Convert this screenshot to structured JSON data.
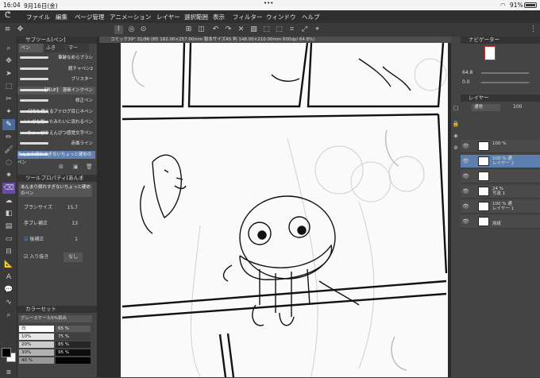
{
  "status_bar": {
    "time": "16:04",
    "date": "9月16日(金)",
    "battery": "91%",
    "dots": "•••"
  },
  "menu": [
    "ファイル",
    "編集",
    "ページ管理",
    "アニメーション",
    "レイヤー",
    "選択範囲",
    "表示",
    "フィルター",
    "ウィンドウ",
    "ヘルプ"
  ],
  "document_tab": "コミック39° 31/86 (B5 182.00×257.00mm 製本サイズA5 判 148.00×210.00mm 600dpi 64.8%)",
  "subtool_panel": {
    "title": "サブツール[ペン]",
    "tabs": [
      "ペン",
      "ふき",
      "マー"
    ],
    "brushes": [
      {
        "label": "筆跡なめらブラシ",
        "selected": false,
        "wide": false
      },
      {
        "label": "軽チャペン2",
        "selected": false,
        "wide": false
      },
      {
        "label": "ブリスター",
        "selected": false,
        "wide": false
      },
      {
        "label": "【再UP】 漫画インクペン",
        "selected": false,
        "wide": true
      },
      {
        "label": "修正ペン",
        "selected": false,
        "wide": false
      },
      {
        "label": "何でも使えるアナログ目じネペン",
        "selected": false,
        "wide": false
      },
      {
        "label": "トンボを削ったみたいに流れるペン",
        "selected": false,
        "wide": false
      },
      {
        "label": "ちょっぴりえんぴつ感覚文字ペン",
        "selected": false,
        "wide": false
      },
      {
        "label": "赤面ライン",
        "selected": false,
        "wide": false
      },
      {
        "label": "あんまり倒れすぎないちょっと硬めのペン",
        "selected": true,
        "wide": false
      }
    ]
  },
  "tool_property": {
    "title": "ツールプロパティ[あんま",
    "preset": "あんまり倒れすぎないちょっと硬めのペン",
    "brush_size_label": "ブラシサイズ",
    "brush_size_value": "15.7",
    "stabilization_label": "手ブレ補正",
    "stabilization_value": "13",
    "post_correction_label": "後補正",
    "post_correction_value": "1",
    "entry_exit_label": "入り抜き",
    "entry_exit_value": "なし"
  },
  "color_set": {
    "title": "カラーセット",
    "set_name": "グレースケール5%刻み",
    "grays": [
      {
        "label": "白",
        "pct": "65 %",
        "left": "#ffffff",
        "right": "#595959"
      },
      {
        "label": "10%",
        "pct": "75 %",
        "left": "#e6e6e6",
        "right": "#404040"
      },
      {
        "label": "20%",
        "pct": "85 %",
        "left": "#cccccc",
        "right": "#262626"
      },
      {
        "label": "30%",
        "pct": "95 %",
        "left": "#b3b3b3",
        "right": "#0d0d0d"
      },
      {
        "label": "40 %",
        "pct": "",
        "left": "#999999",
        "right": "#000000"
      }
    ]
  },
  "navigator": {
    "title": "ナビゲーター",
    "zoom": "64.8",
    "angle": "0.0"
  },
  "layer_panel": {
    "title": "レイヤー",
    "blend_mode": "通常",
    "opacity": "100",
    "layers": [
      {
        "opacity": "100 %",
        "name": "",
        "selected": false
      },
      {
        "opacity": "100 % 通",
        "name": "レイヤー 2",
        "selected": true
      },
      {
        "opacity": "",
        "name": "",
        "selected": false
      },
      {
        "opacity": "24 %",
        "name": "写真 1",
        "selected": false
      },
      {
        "opacity": "100 % 通",
        "name": "レイヤー 1",
        "selected": false
      },
      {
        "opacity": "",
        "name": "用紙",
        "selected": false
      }
    ]
  },
  "colors": {
    "accent": "#5c7faf",
    "selected_brush": "#5f7fb0",
    "menubar": "#2f2f2f",
    "panel": "#444444"
  }
}
